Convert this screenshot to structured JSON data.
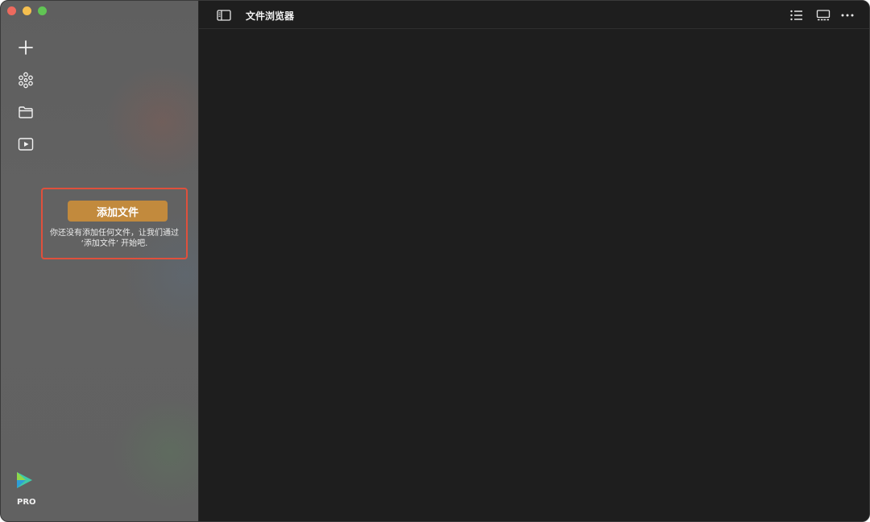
{
  "toolbar": {
    "title": "文件浏览器",
    "icons": [
      "sidebar-toggle-icon",
      "list-view-icon",
      "gallery-view-icon",
      "more-icon"
    ]
  },
  "sidebar": {
    "rail_icons": [
      "plus-icon",
      "network-icon",
      "folder-icon",
      "play-icon"
    ],
    "empty_state": {
      "button_label": "添加文件",
      "message_line1": "你还没有添加任何文件，让我们通过",
      "message_line2": "‘添加文件’ 开始吧."
    },
    "badge": "PRO"
  },
  "colors": {
    "accent": "#c28a3d",
    "highlight_border": "#e0503c",
    "close": "#ed6a5e",
    "minimize": "#f5bf4f",
    "zoom": "#61c554",
    "main_bg": "#1e1e1e"
  }
}
